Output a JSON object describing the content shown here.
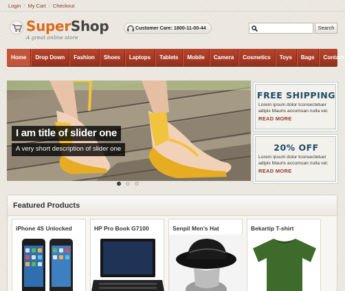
{
  "toplinks": [
    "Login",
    "My Cart",
    "Checkout"
  ],
  "logo": {
    "part1": "Super",
    "part2": "Shop",
    "tagline": "A great online store"
  },
  "customer_care": "Customer Care: 1800-11-00-44",
  "search": {
    "placeholder": "",
    "button": "Search"
  },
  "nav": [
    "Home",
    "Drop Down",
    "Fashion",
    "Shoes",
    "Laptops",
    "Tablets",
    "Mobile",
    "Camera",
    "Cosmetics",
    "Toys",
    "Bags",
    "Contact Us"
  ],
  "nav_active": "Home",
  "slider": {
    "title": "I am title of slider one",
    "description": "A very short description of slider one",
    "dots": 3,
    "active_dot": 1
  },
  "promos": [
    {
      "title": "FREE SHIPPING",
      "text": "Lorem ipsum dolor tconsectetuer adipis Mauris accumsan nulla vel.",
      "more": "READ MORE"
    },
    {
      "title": "20% OFF",
      "text": "Lorem ipsum dolor tconsectetuer adipis Mauris accumsan nulla vel.",
      "more": "READ MORE"
    }
  ],
  "featured": {
    "title": "Featured Products",
    "products": [
      "iPhone 4S Unlocked",
      "HP Pro Book G7100",
      "Senpil Men's Hat",
      "Bekartip T-shirt"
    ]
  },
  "colors": {
    "accent": "#d96a1e",
    "nav": "#a63b25",
    "promo_title": "#1d4b63",
    "link": "#8b3a2b"
  }
}
